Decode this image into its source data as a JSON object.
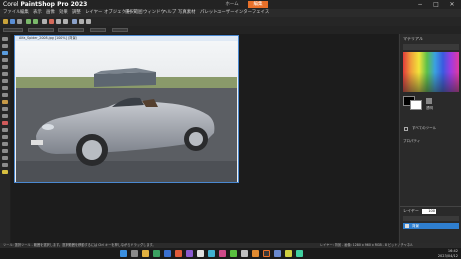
{
  "app": {
    "brand_prefix": "Corel",
    "brand_name": "PaintShop Pro 2023",
    "tab_home": "ホーム",
    "tab_edit": "編集",
    "win_min": "−",
    "win_max": "□",
    "win_close": "✕"
  },
  "menu": [
    "ファイル",
    "編集",
    "表示",
    "画像",
    "効果",
    "調整",
    "レイヤー",
    "オブジェクト",
    "選択範囲",
    "ウィンドウ",
    "ヘルプ",
    "写真素材",
    "パレット",
    "ユーザーインターフェイス"
  ],
  "image_window": {
    "title": "Alfa_Spider_2008.jpg [100%] (背景)"
  },
  "panels": {
    "materials_title": "マテリアル",
    "transparent_label": "透明",
    "all_tools_label": "すべてのツール",
    "properties_label": "プロパティ",
    "layers_title": "レイヤー",
    "layers_value": "100",
    "layer_name": "背景"
  },
  "status": {
    "left": "ツール: 選択ツール - 範囲を選択します。選択範囲を移動するには Ctrl キーを押しながらドラッグします。",
    "right": "レイヤー: 背景 - 画像: 1280 x 960 x RGB - 8 ビット / チャネル"
  },
  "taskbar": {
    "time": "16:42",
    "date": "2023/04/12"
  },
  "colors": {
    "accent": "#e8702a",
    "selected_layer": "#2f7fd0"
  }
}
